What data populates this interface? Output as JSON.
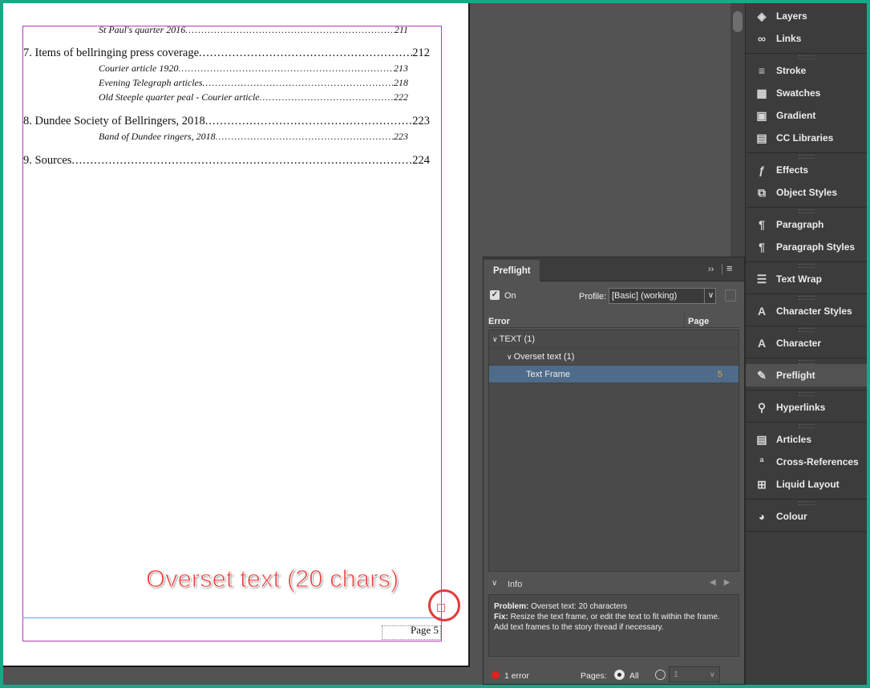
{
  "document": {
    "toc": [
      {
        "kind": "sub",
        "text": "St Paul's quarter 2016",
        "page": "211"
      },
      {
        "kind": "main",
        "text": "7.  Items of bellringing press coverage ",
        "page": "212"
      },
      {
        "kind": "sub",
        "text": "Courier article 1920",
        "page": "213"
      },
      {
        "kind": "sub",
        "text": "Evening Telegraph articles ",
        "page": "218"
      },
      {
        "kind": "sub",
        "text": "Old Steeple quarter peal - Courier article ",
        "page": "222"
      },
      {
        "kind": "main",
        "text": "8.  Dundee Society of Bellringers, 2018 ",
        "page": "223"
      },
      {
        "kind": "sub",
        "text": "Band of Dundee ringers, 2018",
        "page": "223"
      },
      {
        "kind": "main",
        "text": "9.  Sources",
        "page": "224"
      }
    ],
    "page_number": "Page 5",
    "overset_annotation": "Overset text (20 chars)"
  },
  "dock": {
    "groups": [
      [
        {
          "label": "Layers",
          "icon": "layers-icon"
        },
        {
          "label": "Links",
          "icon": "links-icon"
        }
      ],
      [
        {
          "label": "Stroke",
          "icon": "stroke-icon"
        },
        {
          "label": "Swatches",
          "icon": "swatches-icon"
        },
        {
          "label": "Gradient",
          "icon": "gradient-icon"
        },
        {
          "label": "CC Libraries",
          "icon": "cc-libraries-icon"
        }
      ],
      [
        {
          "label": "Effects",
          "icon": "effects-icon"
        },
        {
          "label": "Object Styles",
          "icon": "object-styles-icon"
        }
      ],
      [
        {
          "label": "Paragraph",
          "icon": "paragraph-icon"
        },
        {
          "label": "Paragraph Styles",
          "icon": "paragraph-styles-icon"
        }
      ],
      [
        {
          "label": "Text Wrap",
          "icon": "text-wrap-icon"
        }
      ],
      [
        {
          "label": "Character Styles",
          "icon": "character-styles-icon"
        }
      ],
      [
        {
          "label": "Character",
          "icon": "character-icon"
        }
      ],
      [
        {
          "label": "Preflight",
          "icon": "preflight-icon",
          "active": true
        }
      ],
      [
        {
          "label": "Hyperlinks",
          "icon": "hyperlinks-icon"
        }
      ],
      [
        {
          "label": "Articles",
          "icon": "articles-icon"
        },
        {
          "label": "Cross-References",
          "icon": "cross-references-icon"
        },
        {
          "label": "Liquid Layout",
          "icon": "liquid-layout-icon"
        }
      ],
      [
        {
          "label": "Colour",
          "icon": "colour-icon"
        }
      ]
    ]
  },
  "preflight": {
    "tab": "Preflight",
    "collapse_glyph": "››",
    "menu_glyph": "≡",
    "on_label": "On",
    "profile_label": "Profile:",
    "profile_value": "[Basic] (working)",
    "col_error": "Error",
    "col_page": "Page",
    "rows": [
      {
        "label": "TEXT (1)",
        "indent": 0,
        "chevron": "∨",
        "page": ""
      },
      {
        "label": "Overset text (1)",
        "indent": 1,
        "chevron": "∨",
        "page": ""
      },
      {
        "label": "Text Frame",
        "indent": 2,
        "chevron": "",
        "page": "5",
        "selected": true
      }
    ],
    "info_label": "Info",
    "info": {
      "problem_label": "Problem:",
      "problem_text": "Overset text: 20 characters",
      "fix_label": "Fix:",
      "fix_text": "Resize the text frame, or edit the text to fit within the frame.",
      "fix_text2": "Add text frames to the story thread if necessary."
    },
    "footer": {
      "errors": "1 error",
      "pages_label": "Pages:",
      "all_label": "All",
      "range_value": "1"
    }
  },
  "colors": {
    "accent_frame": "#18a888",
    "error_red": "#e02020",
    "selection_blue": "#4f6b8a",
    "margin_magenta": "#b23ab8",
    "page_number_orange": "#e8a13c"
  }
}
